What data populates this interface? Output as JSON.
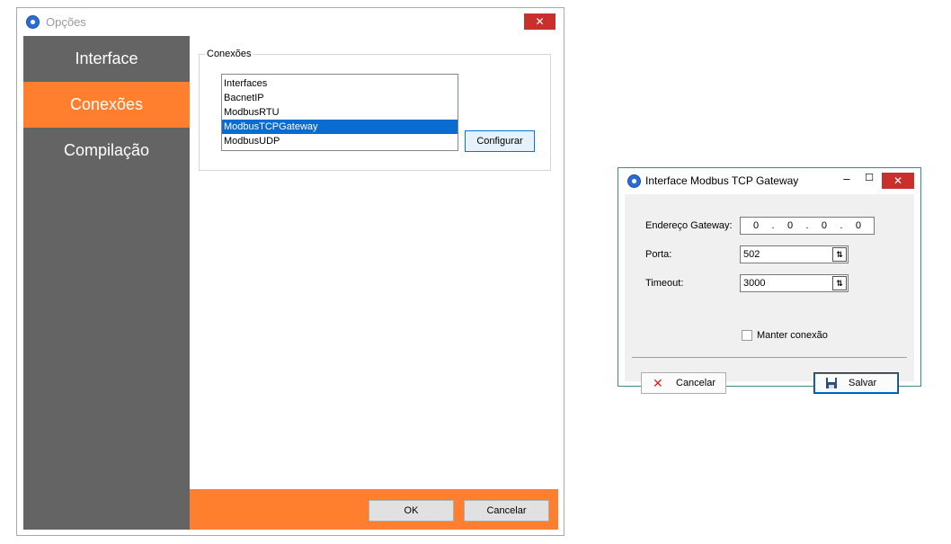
{
  "main_window": {
    "title": "Opções",
    "close_glyph": "✕",
    "sidebar": {
      "items": [
        {
          "label": "Interface"
        },
        {
          "label": "Conexões"
        },
        {
          "label": "Compilação"
        }
      ],
      "active": "Conexões"
    },
    "group_title": "Conexões",
    "list_items": [
      "Interfaces",
      "BacnetIP",
      "ModbusRTU",
      "ModbusTCPGateway",
      "ModbusUDP"
    ],
    "selected_item": "ModbusTCPGateway",
    "configure_label": "Configurar",
    "ok_label": "OK",
    "cancel_label": "Cancelar",
    "colors": {
      "accent": "#ff7f2e",
      "sidebar": "#646464",
      "selection": "#0a6bd0"
    }
  },
  "dialog": {
    "title": "Interface Modbus TCP Gateway",
    "minimize_glyph": "–",
    "maximize_glyph": "☐",
    "close_glyph": "✕",
    "gateway_label": "Endereço Gateway:",
    "ip_octets": [
      "0",
      ".",
      "0",
      ".",
      "0",
      ".",
      "0"
    ],
    "port_label": "Porta:",
    "port_value": "502",
    "timeout_label": "Timeout:",
    "timeout_value": "3000",
    "keep_connection_label": "Manter conexão",
    "keep_connection_checked": false,
    "cancel_label": "Cancelar",
    "save_label": "Salvar",
    "icons": {
      "cancel": "x-icon",
      "save": "floppy-icon",
      "spinner": "spin-arrows-icon"
    }
  }
}
